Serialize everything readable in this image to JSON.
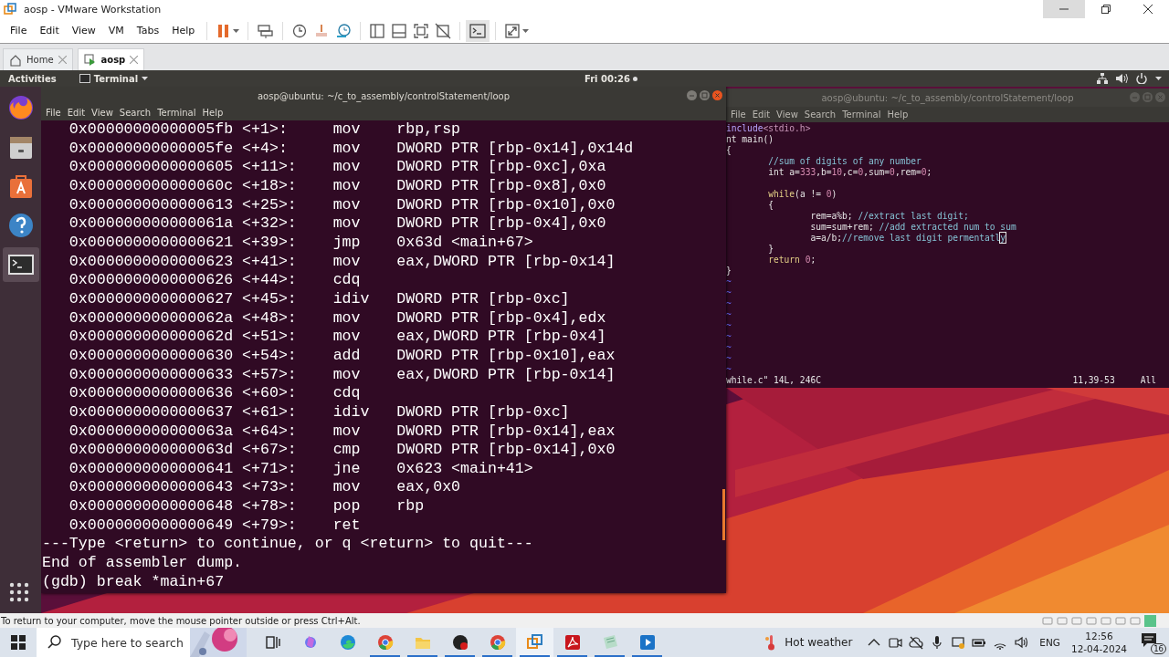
{
  "window": {
    "title": "aosp - VMware Workstation"
  },
  "menu": [
    "File",
    "Edit",
    "View",
    "VM",
    "Tabs",
    "Help"
  ],
  "tabs": [
    {
      "label": "Home",
      "selected": false
    },
    {
      "label": "aosp",
      "selected": true
    }
  ],
  "guest": {
    "activities": "Activities",
    "app_menu": "Terminal",
    "clock": "Fri 00:26",
    "dock": [
      {
        "selected": false
      },
      {
        "selected": false
      },
      {
        "selected": false
      },
      {
        "selected": false
      },
      {
        "selected": true
      }
    ],
    "gdb_terminal": {
      "title": "aosp@ubuntu: ~/c_to_assembly/controlStatement/loop",
      "active": true,
      "menu": [
        "File",
        "Edit",
        "View",
        "Search",
        "Terminal",
        "Help"
      ],
      "lines": [
        {
          "kind": "instruction",
          "text": "0x00000000000005fb <+1>:\tmov    rbp,rsp"
        },
        {
          "kind": "instruction",
          "text": "0x00000000000005fe <+4>:\tmov    DWORD PTR [rbp-0x14],0x14d"
        },
        {
          "kind": "instruction",
          "text": "0x0000000000000605 <+11>:\tmov    DWORD PTR [rbp-0xc],0xa"
        },
        {
          "kind": "instruction",
          "text": "0x000000000000060c <+18>:\tmov    DWORD PTR [rbp-0x8],0x0"
        },
        {
          "kind": "instruction",
          "text": "0x0000000000000613 <+25>:\tmov    DWORD PTR [rbp-0x10],0x0"
        },
        {
          "kind": "instruction",
          "text": "0x000000000000061a <+32>:\tmov    DWORD PTR [rbp-0x4],0x0"
        },
        {
          "kind": "instruction",
          "text": "0x0000000000000621 <+39>:\tjmp    0x63d <main+67>"
        },
        {
          "kind": "instruction",
          "text": "0x0000000000000623 <+41>:\tmov    eax,DWORD PTR [rbp-0x14]"
        },
        {
          "kind": "instruction",
          "text": "0x0000000000000626 <+44>:\tcdq"
        },
        {
          "kind": "instruction",
          "text": "0x0000000000000627 <+45>:\tidiv   DWORD PTR [rbp-0xc]"
        },
        {
          "kind": "instruction",
          "text": "0x000000000000062a <+48>:\tmov    DWORD PTR [rbp-0x4],edx"
        },
        {
          "kind": "instruction",
          "text": "0x000000000000062d <+51>:\tmov    eax,DWORD PTR [rbp-0x4]"
        },
        {
          "kind": "instruction",
          "text": "0x0000000000000630 <+54>:\tadd    DWORD PTR [rbp-0x10],eax"
        },
        {
          "kind": "instruction",
          "text": "0x0000000000000633 <+57>:\tmov    eax,DWORD PTR [rbp-0x14]"
        },
        {
          "kind": "instruction",
          "text": "0x0000000000000636 <+60>:\tcdq"
        },
        {
          "kind": "instruction",
          "text": "0x0000000000000637 <+61>:\tidiv   DWORD PTR [rbp-0xc]"
        },
        {
          "kind": "instruction",
          "text": "0x000000000000063a <+64>:\tmov    DWORD PTR [rbp-0x14],eax"
        },
        {
          "kind": "instruction",
          "text": "0x000000000000063d <+67>:\tcmp    DWORD PTR [rbp-0x14],0x0"
        },
        {
          "kind": "instruction",
          "text": "0x0000000000000641 <+71>:\tjne    0x623 <main+41>"
        },
        {
          "kind": "instruction",
          "text": "0x0000000000000643 <+73>:\tmov    eax,0x0"
        },
        {
          "kind": "instruction",
          "text": "0x0000000000000648 <+78>:\tpop    rbp"
        },
        {
          "kind": "instruction",
          "text": "0x0000000000000649 <+79>:\tret"
        },
        {
          "kind": "output",
          "text": "---Type <return> to continue, or q <return> to quit---"
        },
        {
          "kind": "output",
          "text": "End of assembler dump."
        },
        {
          "kind": "prompt",
          "text": "(gdb) break *main+67"
        }
      ]
    },
    "vim_terminal": {
      "title": "aosp@ubuntu: ~/c_to_assembly/controlStatement/loop",
      "active": false,
      "menu": [
        "File",
        "Edit",
        "View",
        "Search",
        "Terminal",
        "Help"
      ],
      "lines": [
        {
          "kind": "code",
          "segments": [
            {
              "kind": "preproc",
              "text": "include"
            },
            {
              "kind": "header",
              "text": "<stdio.h>"
            }
          ]
        },
        {
          "kind": "code",
          "segments": [
            {
              "kind": "normal",
              "text": "nt main()"
            }
          ]
        },
        {
          "kind": "code",
          "segments": [
            {
              "kind": "normal",
              "text": "{"
            }
          ]
        },
        {
          "kind": "code",
          "segments": [
            {
              "kind": "comment",
              "text": "\t//sum of digits of any number"
            }
          ]
        },
        {
          "kind": "code",
          "segments": [
            {
              "kind": "normal",
              "text": "\tint a="
            },
            {
              "kind": "number",
              "text": "333"
            },
            {
              "kind": "normal",
              "text": ",b="
            },
            {
              "kind": "number",
              "text": "10"
            },
            {
              "kind": "normal",
              "text": ",c="
            },
            {
              "kind": "number",
              "text": "0"
            },
            {
              "kind": "normal",
              "text": ",sum="
            },
            {
              "kind": "number",
              "text": "0"
            },
            {
              "kind": "normal",
              "text": ",rem="
            },
            {
              "kind": "number",
              "text": "0"
            },
            {
              "kind": "normal",
              "text": ";"
            }
          ]
        },
        {
          "kind": "blank"
        },
        {
          "kind": "code",
          "segments": [
            {
              "kind": "keyword",
              "text": "\twhile"
            },
            {
              "kind": "normal",
              "text": "(a != "
            },
            {
              "kind": "number",
              "text": "0"
            },
            {
              "kind": "normal",
              "text": ")"
            }
          ]
        },
        {
          "kind": "code",
          "segments": [
            {
              "kind": "normal",
              "text": "\t{"
            }
          ]
        },
        {
          "kind": "code",
          "segments": [
            {
              "kind": "normal",
              "text": "\t\trem=a%b; "
            },
            {
              "kind": "comment",
              "text": "//extract last digit;"
            }
          ]
        },
        {
          "kind": "code",
          "segments": [
            {
              "kind": "normal",
              "text": "\t\tsum=sum+rem; "
            },
            {
              "kind": "comment",
              "text": "//add extracted num to sum"
            }
          ]
        },
        {
          "kind": "code",
          "segments": [
            {
              "kind": "normal",
              "text": "\t\ta=a/b;"
            },
            {
              "kind": "comment",
              "text": "//remove last digit permentatl"
            },
            {
              "kind": "cursor",
              "text": "y"
            }
          ]
        },
        {
          "kind": "code",
          "segments": [
            {
              "kind": "normal",
              "text": "\t}"
            }
          ]
        },
        {
          "kind": "code",
          "segments": [
            {
              "kind": "keyword",
              "text": "\treturn "
            },
            {
              "kind": "number",
              "text": "0"
            },
            {
              "kind": "normal",
              "text": ";"
            }
          ]
        },
        {
          "kind": "code",
          "segments": [
            {
              "kind": "normal",
              "text": "}"
            }
          ]
        },
        {
          "kind": "tilde",
          "text": "~"
        },
        {
          "kind": "tilde",
          "text": "~"
        },
        {
          "kind": "tilde",
          "text": "~"
        },
        {
          "kind": "tilde",
          "text": "~"
        },
        {
          "kind": "tilde",
          "text": "~"
        },
        {
          "kind": "tilde",
          "text": "~"
        },
        {
          "kind": "tilde",
          "text": "~"
        },
        {
          "kind": "tilde",
          "text": "~"
        },
        {
          "kind": "tilde",
          "text": "~"
        }
      ],
      "status_file": "while.c\" 14L, 246C",
      "status_position": "11,39-53",
      "status_scroll": "All"
    }
  },
  "status_message": "To return to your computer, move the mouse pointer outside or press Ctrl+Alt.",
  "taskbar": {
    "search_placeholder": "Type here to search",
    "apps": [
      {
        "running": false,
        "selected": false
      },
      {
        "running": false,
        "selected": false
      },
      {
        "running": false,
        "selected": false
      },
      {
        "running": true,
        "selected": false
      },
      {
        "running": true,
        "selected": false
      },
      {
        "running": true,
        "selected": false
      },
      {
        "running": true,
        "selected": false
      },
      {
        "running": true,
        "selected": true
      },
      {
        "running": true,
        "selected": false
      },
      {
        "running": true,
        "selected": false
      },
      {
        "running": true,
        "selected": false
      }
    ],
    "weather": "Hot weather",
    "language": "ENG",
    "time": "12:56",
    "date": "12-04-2024",
    "notifications": "16"
  }
}
